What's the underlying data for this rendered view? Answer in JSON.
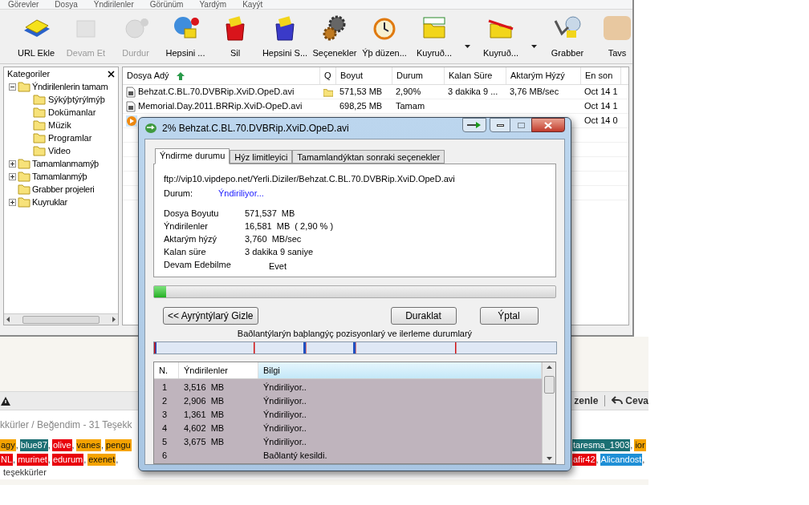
{
  "forum": {
    "toolbar_right": [
      {
        "label": "zenle"
      },
      {
        "label": "Ceva"
      }
    ],
    "thanks_line": "kkürler / Beğendim - 31 Teşekk",
    "tag_lines_left": [
      [
        {
          "label": "agy",
          "color": "#f5a300",
          "suffix": ","
        },
        {
          "label": "blue87",
          "color": "#1b6f73",
          "suffix": ","
        },
        {
          "label": "olive",
          "color": "#e8000b",
          "suffix": ","
        },
        {
          "label": "vanes",
          "color": "#f5a300",
          "suffix": ","
        },
        {
          "label": "pengu",
          "color": "#f5a300"
        }
      ],
      [
        {
          "label": "NL",
          "color": "#e8000b",
          "suffix": ","
        },
        {
          "label": "murinet",
          "color": "#e8000b",
          "suffix": ","
        },
        {
          "label": "edurum",
          "color": "#e8000b",
          "suffix": ","
        },
        {
          "label": "exenet",
          "color": "#f5a300",
          "suffix": ","
        }
      ]
    ],
    "tag_lines_right": [
      [
        {
          "label": "taresma_1903",
          "color": "#1b6f73",
          "suffix": ","
        },
        {
          "label": "ior",
          "color": "#f5a300"
        }
      ],
      [
        {
          "label": "afir42",
          "color": "#e8000b",
          "suffix": ","
        },
        {
          "label": "Alicandost",
          "color": "#1e8fd6",
          "suffix": ","
        }
      ]
    ],
    "footer": "teşekkürler"
  },
  "window": {
    "menu": [
      "Görevler",
      "Dosya",
      "Ýndirilenler",
      "Görünüm",
      "Yardým",
      "Kayýt"
    ],
    "toolbar": [
      {
        "label": "URL Ekle",
        "disabled": false,
        "dropdown": false
      },
      {
        "label": "Devam Et",
        "disabled": true,
        "dropdown": false
      },
      {
        "label": "Durdur",
        "disabled": true,
        "dropdown": false
      },
      {
        "label": "Hepsini ...",
        "disabled": false,
        "dropdown": false
      },
      {
        "label": "Sil",
        "disabled": false,
        "dropdown": false
      },
      {
        "label": "Hepsini S...",
        "disabled": false,
        "dropdown": false
      },
      {
        "label": "Seçenekler",
        "disabled": false,
        "dropdown": false
      },
      {
        "label": "Ýþ düzen...",
        "disabled": false,
        "dropdown": false
      },
      {
        "label": "Kuyruð...",
        "disabled": false,
        "dropdown": true
      },
      {
        "label": "Kuyruð...",
        "disabled": false,
        "dropdown": true
      },
      {
        "label": "Grabber",
        "disabled": false,
        "dropdown": false
      },
      {
        "label": "Tavs",
        "disabled": false,
        "dropdown": false
      }
    ],
    "categories": {
      "title": "Kategoriler",
      "tree": [
        {
          "label": "Ýndirilenlerin tamam",
          "kind": "group",
          "expanded": true,
          "children": [
            {
              "label": "Sýkýþtýrýlmýþ"
            },
            {
              "label": "Dokümanlar"
            },
            {
              "label": "Müzik"
            },
            {
              "label": "Programlar"
            },
            {
              "label": "Video"
            }
          ]
        },
        {
          "label": "Tamamlanmamýþ",
          "kind": "group",
          "expanded": false
        },
        {
          "label": "Tamamlanmýþ",
          "kind": "group",
          "expanded": false
        },
        {
          "label": "Grabber projeleri",
          "kind": "leaf"
        },
        {
          "label": "Kuyruklar",
          "kind": "group",
          "expanded": false
        }
      ]
    },
    "files": {
      "columns": [
        "Dosya Adý",
        "Q",
        "Boyut",
        "Durum",
        "Kalan Süre",
        "Aktarým Hýzý",
        "En son"
      ],
      "rows": [
        {
          "kind": "file",
          "queued": true,
          "cells": [
            "Behzat.C.BL.70.DVBRip.XviD.OpeD.avi",
            "",
            "571,53  MB",
            "2,90%",
            "3 dakika 9 ...",
            "3,76  MB/sec",
            "Oct 14 1"
          ]
        },
        {
          "kind": "file",
          "queued": false,
          "cells": [
            "Memorial.Day.2011.BRRip.XviD-OpeD.avi",
            "",
            "698,25  MB",
            "Tamam",
            "",
            "",
            "Oct 14 1"
          ]
        },
        {
          "kind": "playing",
          "queued": false,
          "cells": [
            "",
            "",
            "",
            "",
            "",
            "",
            "Oct 14 0"
          ]
        }
      ]
    }
  },
  "dialog": {
    "title": "2% Behzat.C.BL.70.DVBRip.XviD.OpeD.avi",
    "tabs": [
      {
        "label": "Ýndirme durumu",
        "selected": true
      },
      {
        "label": "Hýz limitleyici",
        "selected": false
      },
      {
        "label": "Tamamlandýktan sonraki seçenekler",
        "selected": false
      }
    ],
    "url": "ftp://vip10.vipdepo.net/Yerli.Diziler/Behzat.C.BL.70.DVBRip.XviD.OpeD.avi",
    "status": {
      "label": "Durum:",
      "value": "Ýndiriliyor..."
    },
    "details": [
      {
        "kind": "plain",
        "label": "Dosya Boyutu",
        "value": "571,537  MB"
      },
      {
        "kind": "plain",
        "label": "Ýndirilenler",
        "value": "16,581  MB  ( 2,90 % )"
      },
      {
        "kind": "plain",
        "label": "Aktarým hýzý",
        "value": "3,760  MB/sec"
      },
      {
        "kind": "plain",
        "label": "Kalan süre",
        "value": "3 dakika 9 saniye"
      },
      {
        "kind": "flag",
        "label": "Devam Edebilme",
        "value": "Evet"
      }
    ],
    "progress": {
      "level": 0.029
    },
    "buttons": [
      "<< Ayrýntýlarý Gizle",
      "Duraklat",
      "Ýptal"
    ],
    "connections_caption": "Baðlantýlarýn baþlangýç pozisyonlarý ve ilerleme durumlarý",
    "connections": {
      "columns": [
        "N.",
        "Ýndirilenler",
        "Bilgi"
      ],
      "rows": [
        [
          "1",
          "3,516  MB",
          "Ýndiriliyor.."
        ],
        [
          "2",
          "2,906  MB",
          "Ýndiriliyor.."
        ],
        [
          "3",
          "1,361  MB",
          "Ýndiriliyor.."
        ],
        [
          "4",
          "4,602  MB",
          "Ýndiriliyor.."
        ],
        [
          "5",
          "3,675  MB",
          "Ýndiriliyor.."
        ],
        [
          "6",
          "",
          "Baðlantý kesildi."
        ]
      ]
    }
  }
}
